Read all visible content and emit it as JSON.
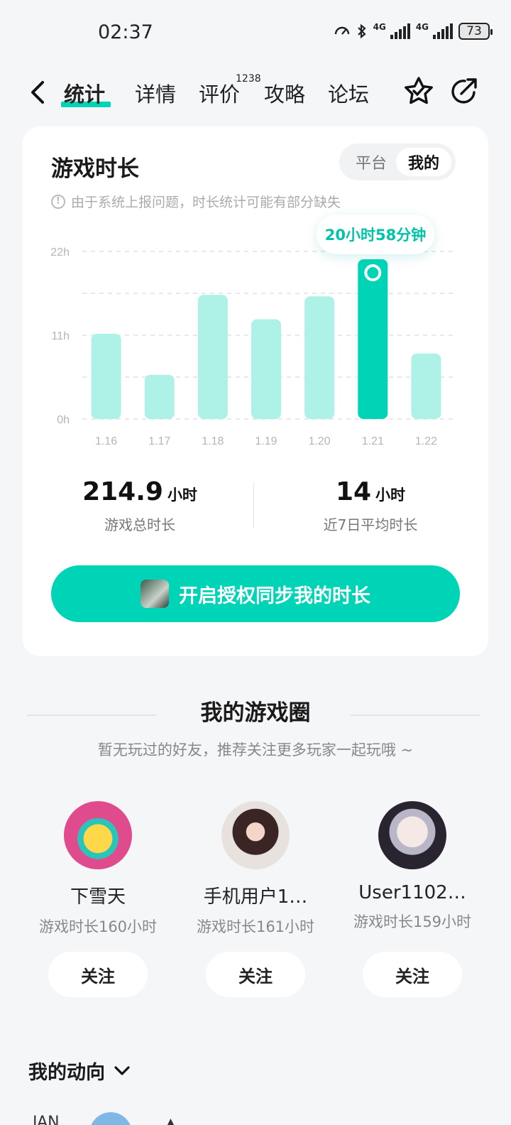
{
  "status_bar": {
    "time": "02:37",
    "battery": "73",
    "network_1": "4G",
    "network_2": "4G"
  },
  "nav": {
    "tabs": [
      {
        "label": "统计",
        "active": true
      },
      {
        "label": "详情",
        "active": false
      },
      {
        "label": "评价",
        "active": false
      },
      {
        "label": "攻略",
        "active": false
      },
      {
        "label": "论坛",
        "active": false
      }
    ],
    "review_count": "1238",
    "icons": [
      "back-icon",
      "favorite-star-icon",
      "share-icon"
    ]
  },
  "playtime_card": {
    "title": "游戏时长",
    "segment": {
      "platform_label": "平台",
      "mine_label": "我的",
      "selected": "我的"
    },
    "notice": "由于系统上报问题，时长统计可能有部分缺失",
    "tooltip": "20小时58分钟",
    "total": {
      "value": "214.9",
      "unit": "小时",
      "label": "游戏总时长"
    },
    "average": {
      "value": "14",
      "unit": "小时",
      "label": "近7日平均时长"
    },
    "cta_label": "开启授权同步我的时长"
  },
  "chart_data": {
    "type": "bar",
    "categories": [
      "1.16",
      "1.17",
      "1.18",
      "1.19",
      "1.20",
      "1.21",
      "1.22"
    ],
    "values": [
      11.2,
      5.8,
      16.3,
      13.1,
      16.1,
      20.97,
      8.6
    ],
    "highlight_index": 5,
    "y_ticks": [
      "0h",
      "11h",
      "22h"
    ],
    "ylim": [
      0,
      22
    ],
    "grid": true,
    "bar_color": "#aef1e7",
    "highlight_color": "#00d4b6"
  },
  "game_circle": {
    "title": "我的游戏圈",
    "subtitle": "暂无玩过的好友，推荐关注更多玩家一起玩哦 ~",
    "friends": [
      {
        "name": "下雪天",
        "playtime": "游戏时长160小时",
        "follow_label": "关注"
      },
      {
        "name": "手机用户1…",
        "playtime": "游戏时长161小时",
        "follow_label": "关注"
      },
      {
        "name": "User1102…",
        "playtime": "游戏时长159小时",
        "follow_label": "关注"
      }
    ]
  },
  "activity": {
    "title": "我的动向",
    "month": "JAN"
  }
}
